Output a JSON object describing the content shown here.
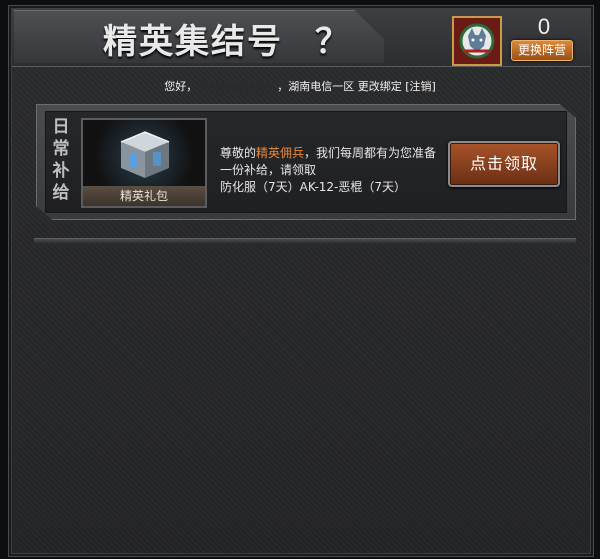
{
  "header": {
    "title": "精英集结号",
    "help_symbol": "？",
    "score": "0",
    "switch_camp_label": "更换阵营",
    "emblem_icon": "wolf-emblem-icon"
  },
  "userline": {
    "greeting": "您好，",
    "region": "，湖南电信一区",
    "rebind_label": "更改绑定",
    "logout_label": "[注销]"
  },
  "supply": {
    "side_label_chars": [
      "日",
      "常",
      "补",
      "给"
    ],
    "item_name": "精英礼包",
    "desc_prefix": "尊敬的",
    "desc_highlight": "精英佣兵",
    "desc_suffix": "，我们每周都有为您准备一份补给，请领取",
    "desc_items": "防化服（7天）AK-12-恶棍（7天）",
    "claim_label": "点击领取"
  },
  "colors": {
    "highlight": "#e8893c",
    "button_orange": "#a8542a",
    "background": "#232426"
  }
}
